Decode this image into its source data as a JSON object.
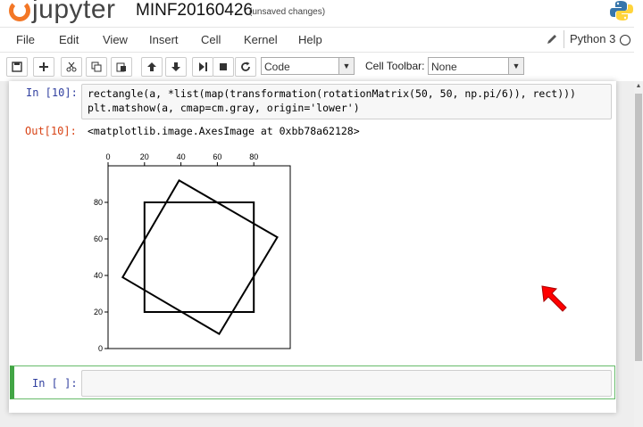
{
  "header": {
    "logo_text": "jupyter",
    "notebook_name": "MINF20160426",
    "save_status": "(unsaved changes)"
  },
  "menu": {
    "items": [
      "File",
      "Edit",
      "View",
      "Insert",
      "Cell",
      "Kernel",
      "Help"
    ],
    "kernel_name": "Python 3"
  },
  "toolbar": {
    "buttons": [
      "save-icon",
      "plus-icon",
      "scissors-icon",
      "copy-icon",
      "paste-icon",
      "arrow-up-icon",
      "arrow-down-icon",
      "step-forward-icon",
      "stop-icon",
      "refresh-icon"
    ],
    "cell_type": "Code",
    "cell_toolbar_label": "Cell Toolbar:",
    "cell_toolbar_value": "None"
  },
  "cells": {
    "in_prompt": "In [10]:",
    "code_line1": "rectangle(a, *list(map(transformation(rotationMatrix(50, 50, np.pi/6)), rect)))",
    "code_line2": "plt.matshow(a, cmap=cm.gray, origin='lower')",
    "out_prompt": "Out[10]:",
    "out_text": "<matplotlib.image.AxesImage at 0xbb78a62128>",
    "empty_prompt": "In [ ]:"
  },
  "chart_data": {
    "type": "image",
    "x_ticks": [
      "0",
      "20",
      "40",
      "60",
      "80"
    ],
    "y_ticks": [
      "0",
      "20",
      "40",
      "60",
      "80"
    ],
    "xlim": [
      0,
      100
    ],
    "ylim": [
      0,
      100
    ],
    "tick_position_x": "top",
    "grid": false,
    "series": [
      {
        "points": [
          [
            20,
            20
          ],
          [
            80,
            20
          ],
          [
            80,
            80
          ],
          [
            20,
            80
          ]
        ]
      },
      {
        "points": [
          [
            61.0,
            8.0
          ],
          [
            92.9,
            60.9
          ],
          [
            39.0,
            92.0
          ],
          [
            8.0,
            39.0
          ]
        ]
      }
    ],
    "line_color": "#000000"
  },
  "colors": {
    "accent": "#f37726",
    "in_prompt": "#303f9f",
    "out_prompt": "#d84315",
    "edit_border": "#66bb6a",
    "cursor": "#ff0000"
  }
}
